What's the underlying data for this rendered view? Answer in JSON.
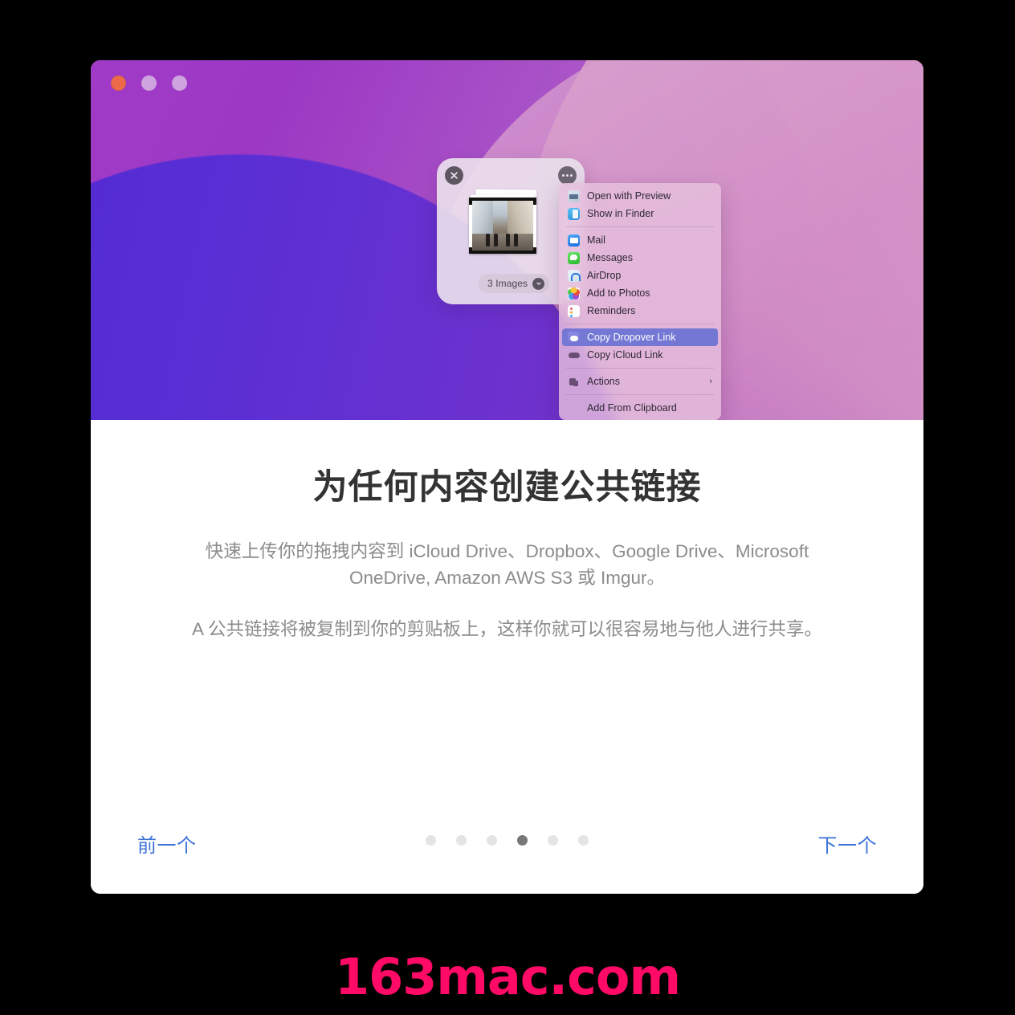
{
  "window": {
    "traffic_lights": [
      {
        "name": "close",
        "color": "#ec6a4a"
      },
      {
        "name": "minimize",
        "color": "#e1cde8"
      },
      {
        "name": "maximize",
        "color": "#e1cde8"
      }
    ]
  },
  "hero": {
    "wallpaper_colors": [
      "#d79cc5",
      "#a84ac4",
      "#9333c2",
      "#4a27d6"
    ],
    "shelf": {
      "close_icon": "close-icon",
      "more_icon": "ellipsis-icon",
      "item_count_label": "3 Images",
      "chevron_icon": "chevron-down-icon"
    },
    "context_menu": {
      "items": [
        {
          "label": "Open with Preview",
          "icon": "preview-icon",
          "selected": false
        },
        {
          "label": "Show in Finder",
          "icon": "finder-icon",
          "selected": false
        },
        {
          "separator": true
        },
        {
          "label": "Mail",
          "icon": "mail-icon",
          "selected": false
        },
        {
          "label": "Messages",
          "icon": "messages-icon",
          "selected": false
        },
        {
          "label": "AirDrop",
          "icon": "airdrop-icon",
          "selected": false
        },
        {
          "label": "Add to Photos",
          "icon": "photos-icon",
          "selected": false
        },
        {
          "label": "Reminders",
          "icon": "reminders-icon",
          "selected": false
        },
        {
          "separator": true
        },
        {
          "label": "Copy Dropover Link",
          "icon": "dropover-icon",
          "selected": true
        },
        {
          "label": "Copy iCloud Link",
          "icon": "icloud-icon",
          "selected": false
        },
        {
          "separator": true
        },
        {
          "label": "Actions",
          "icon": "actions-icon",
          "submenu": true
        },
        {
          "separator": true
        },
        {
          "label": "Add From Clipboard",
          "icon": "none",
          "selected": false
        }
      ],
      "highlight_color": "#7478d4"
    }
  },
  "main": {
    "title": "为任何内容创建公共链接",
    "paragraph_1": "快速上传你的拖拽内容到 iCloud Drive、Dropbox、Google Drive、Microsoft OneDrive, Amazon AWS S3 或 Imgur。",
    "paragraph_2": "A 公共链接将被复制到你的剪贴板上，这样你就可以很容易地与他人进行共享。"
  },
  "footer": {
    "prev_label": "前一个",
    "next_label": "下一个",
    "link_color": "#3b72d9",
    "dots_total": 6,
    "dots_active_index": 4,
    "dot_active_color": "#777777",
    "dot_inactive_color": "#e4e4e4"
  },
  "watermark": {
    "text": "163mac.com",
    "color": "#ff0a66"
  }
}
